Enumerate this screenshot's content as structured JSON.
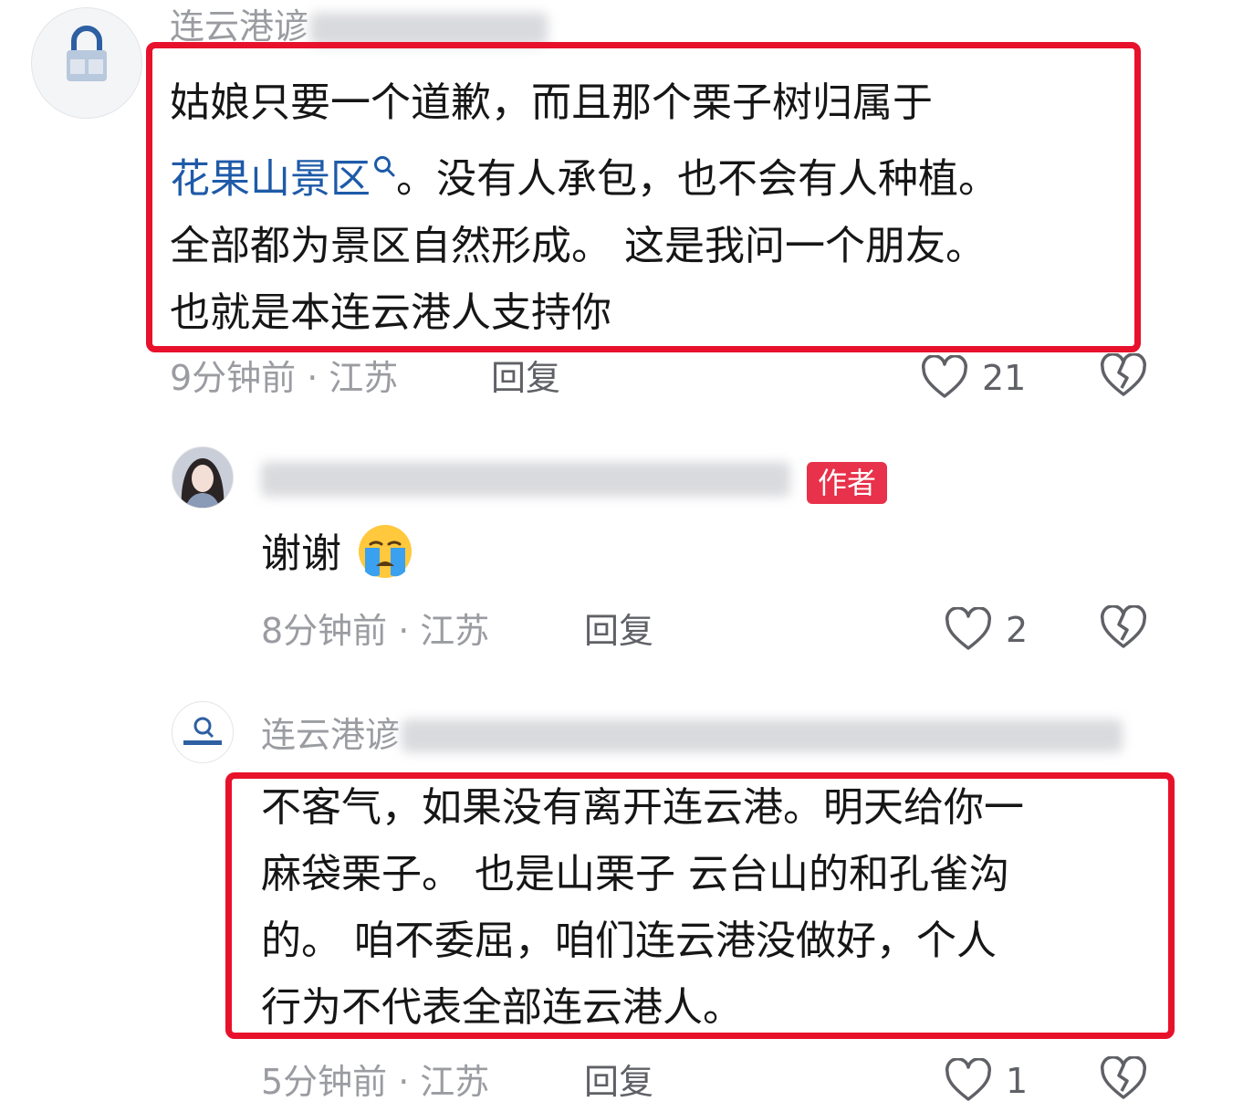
{
  "comments": [
    {
      "username": "连云港谚",
      "text_lines": [
        "姑娘只要一个道歉，而且那个栗子树归属于"
      ],
      "topic_link": "花果山景区",
      "text_after_link": "。没有人承包，也不会有人种植。",
      "text_lines_more": [
        "全部都为景区自然形成。 这是我问一个朋友。",
        "也就是本连云港人支持你"
      ],
      "time": "9分钟前",
      "location": "江苏",
      "reply_label": "回复",
      "likes": "21"
    },
    {
      "username": "",
      "badge": "作者",
      "text": "谢谢",
      "emoji": "😭",
      "time": "8分钟前",
      "location": "江苏",
      "reply_label": "回复",
      "likes": "2"
    },
    {
      "username": "连云港谚",
      "text_lines": [
        "不客气，如果没有离开连云港。明天给你一",
        "麻袋栗子。 也是山栗子 云台山的和孔雀沟",
        "的。 咱不委屈，咱们连云港没做好，个人",
        "行为不代表全部连云港人。"
      ],
      "time": "5分钟前",
      "location": "江苏",
      "reply_label": "回复",
      "likes": "1"
    }
  ],
  "separator": "·",
  "colors": {
    "highlight_border": "#e8112b",
    "link": "#1e5aa8",
    "author_badge": "#e8314a",
    "meta_text": "#9a9ca1"
  },
  "icons": [
    "search-icon",
    "heart-icon",
    "broken-heart-icon",
    "crying-face-emoji"
  ]
}
